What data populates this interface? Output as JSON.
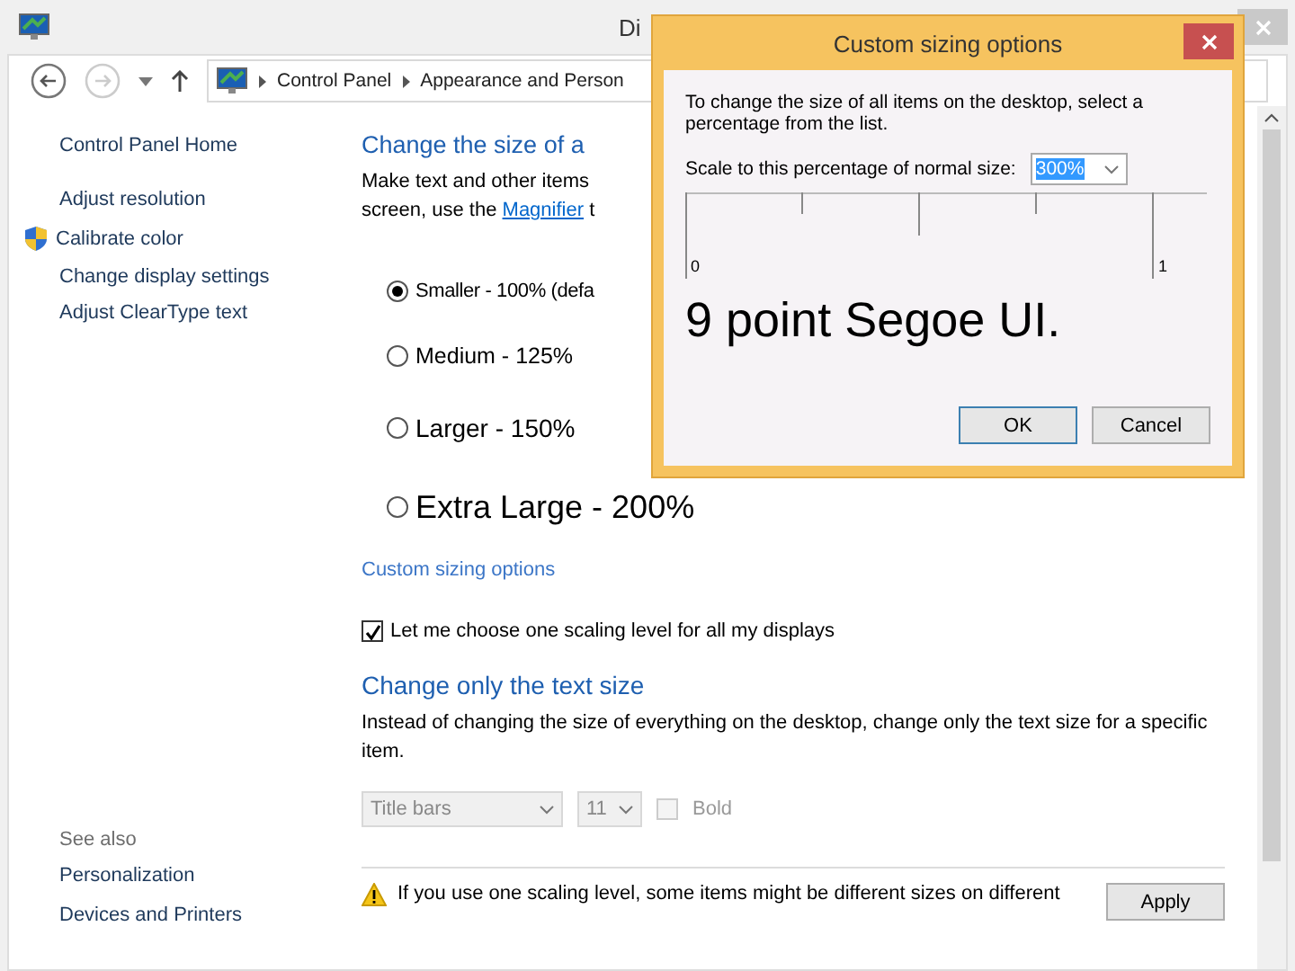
{
  "window": {
    "title": "Di"
  },
  "address_bar": {
    "crumbs": [
      "Control Panel",
      "Appearance and Person"
    ]
  },
  "sidebar": {
    "items": [
      {
        "label": "Control Panel Home",
        "kind": "home"
      },
      {
        "label": "Adjust resolution",
        "kind": "link"
      },
      {
        "label": "Calibrate color",
        "kind": "shield"
      },
      {
        "label": "Change display settings",
        "kind": "link"
      },
      {
        "label": "Adjust ClearType text",
        "kind": "link"
      }
    ],
    "see_also": {
      "title": "See also",
      "items": [
        "Personalization",
        "Devices and Printers"
      ]
    }
  },
  "main": {
    "heading": "Change the size of a",
    "intro_line": "Make text and other items",
    "intro_before": "screen, use the ",
    "intro_link": "Magnifier",
    "intro_after": "t",
    "options": [
      {
        "label": "Smaller - 100% (defa",
        "selected": true
      },
      {
        "label": "Medium - 125%",
        "selected": false
      },
      {
        "label": "Larger - 150%",
        "selected": false
      },
      {
        "label": "Extra Large - 200%",
        "selected": false
      }
    ],
    "custom_link": "Custom sizing options",
    "one_level": {
      "label": "Let me choose one scaling level for all my displays",
      "checked": true
    },
    "text_heading": "Change only the text size",
    "text_intro": "Instead of changing the size of everything on the desktop, change only the text size for a specific item.",
    "item_select": {
      "value": "Title bars",
      "disabled": true
    },
    "size_select": {
      "value": "11",
      "disabled": true
    },
    "bold": {
      "label": "Bold",
      "checked": false,
      "disabled": true
    },
    "warning": "If you use one scaling level, some items might be different sizes on different",
    "apply": "Apply"
  },
  "dialog": {
    "title": "Custom sizing options",
    "text": "To change the size of all items on the desktop, select a percentage from the list.",
    "scale_label": "Scale to this percentage of normal size:",
    "scale_value": "300%",
    "ruler_labels": [
      "0",
      "1"
    ],
    "sample": "9 point Segoe UI.",
    "buttons": [
      "OK",
      "Cancel"
    ]
  }
}
